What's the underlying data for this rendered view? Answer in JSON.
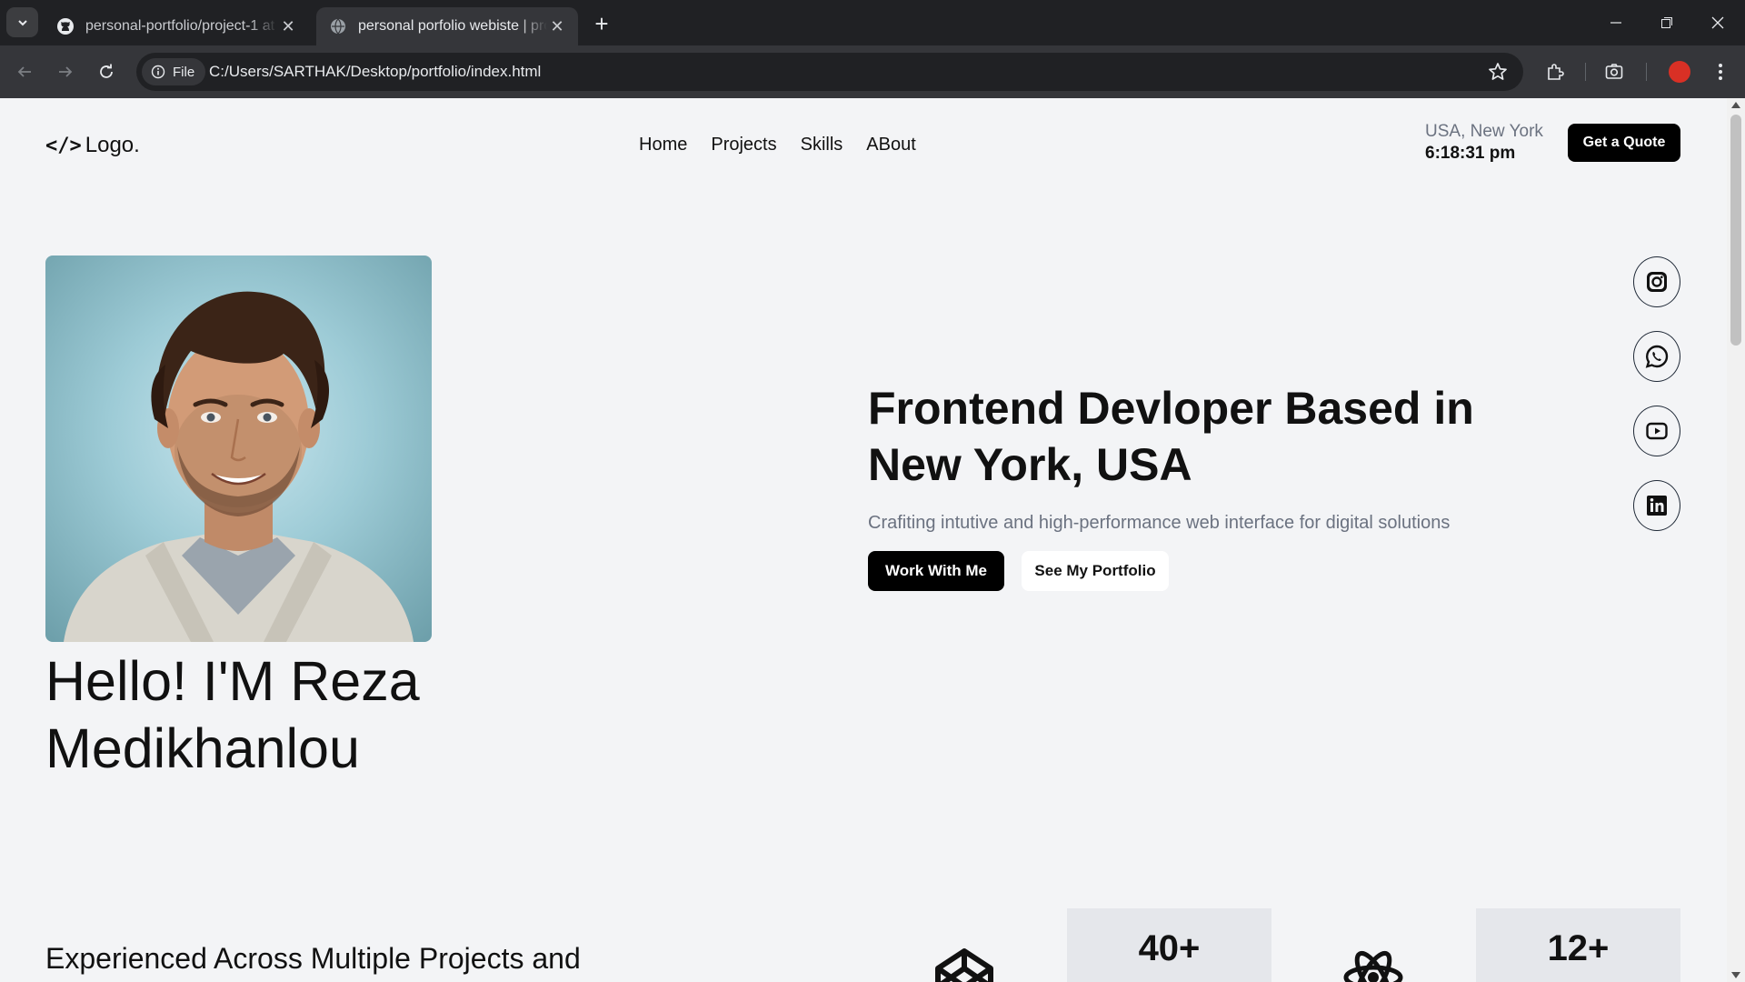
{
  "browser": {
    "tabs": [
      {
        "title": "personal-portfolio/project-1 at",
        "active": false,
        "favicon": "github-icon"
      },
      {
        "title": "personal porfolio webiste | proj",
        "active": true,
        "favicon": "globe-icon"
      }
    ],
    "url_chip": "File",
    "url": "C:/Users/SARTHAK/Desktop/portfolio/index.html"
  },
  "header": {
    "logo_text": "Logo.",
    "logo_icon": "</>",
    "nav": [
      "Home",
      "Projects",
      "Skills",
      "ABout"
    ],
    "location": "USA, New York",
    "time": "6:18:31 pm",
    "cta": "Get a Quote"
  },
  "hero": {
    "greeting": "Hello! I'M Reza Medikhanlou",
    "headline": "Frontend Devloper Based in New York, USA",
    "subline": "Crafiting intutive and high-performance web interface for digital solutions",
    "primary_button": "Work With Me",
    "secondary_button": "See My Portfolio"
  },
  "social": [
    "instagram-icon",
    "whatsapp-icon",
    "youtube-icon",
    "linkedin-icon"
  ],
  "stats": {
    "intro": "Experienced Across Multiple Projects and",
    "items": [
      {
        "value": "40+",
        "icon": "codepen-icon"
      },
      {
        "value": "12+",
        "icon": "react-icon"
      }
    ]
  },
  "colors": {
    "accent": "#000000",
    "page_bg": "#f3f4f6",
    "muted": "#6b7280",
    "card_bg": "#e5e7eb"
  }
}
